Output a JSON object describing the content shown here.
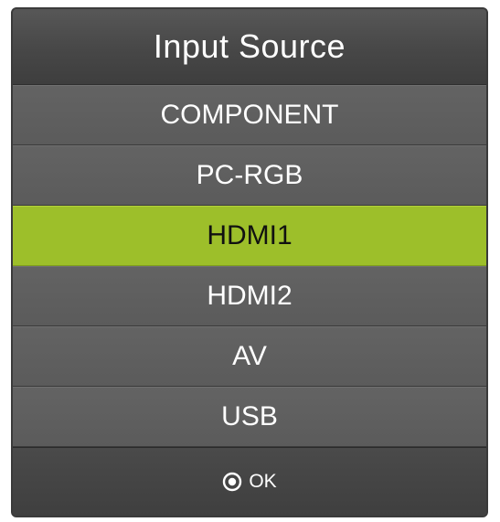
{
  "menu": {
    "title": "Input Source",
    "items": [
      {
        "label": "COMPONENT"
      },
      {
        "label": "PC-RGB"
      },
      {
        "label": "HDMI1"
      },
      {
        "label": "HDMI2"
      },
      {
        "label": "AV"
      },
      {
        "label": "USB"
      }
    ],
    "selected_item": "HDMI1",
    "footer": {
      "icon": "ok-circle-icon",
      "label": "OK"
    }
  },
  "colors": {
    "panel": "#5a5a5a",
    "selected": "#9dbf2a",
    "text": "#ffffff",
    "selected_text": "#111111"
  }
}
